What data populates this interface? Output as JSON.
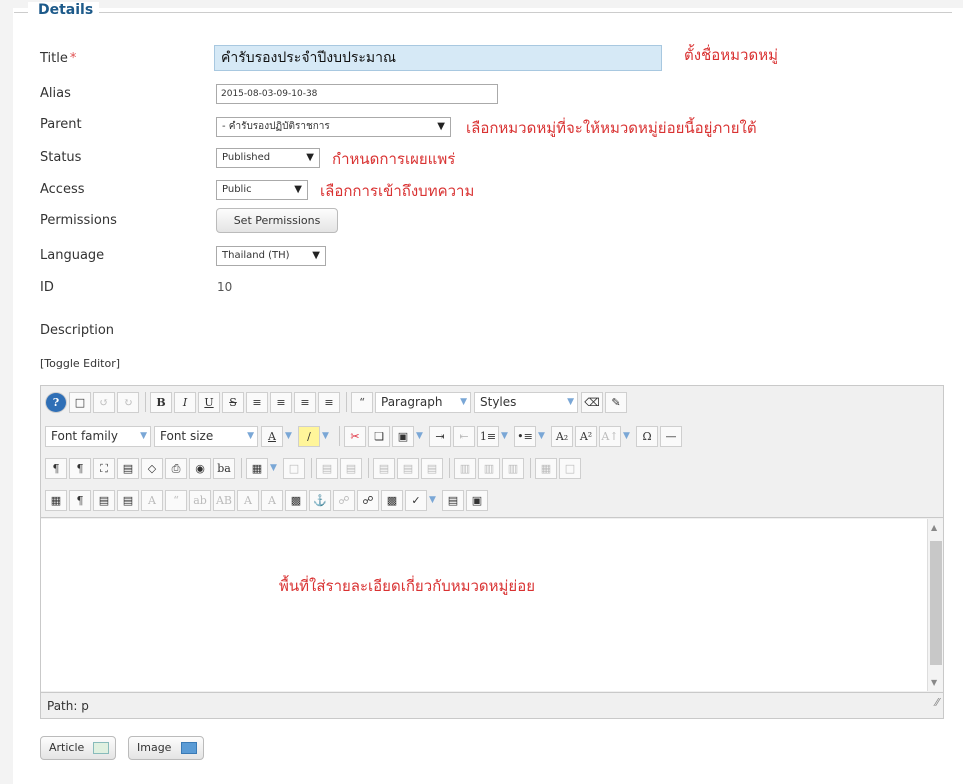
{
  "form": {
    "legend": "Details",
    "title_label": "Title",
    "required_marker": "*",
    "title_value": "คำรับรองประจำปีงบประมาณ",
    "alias_label": "Alias",
    "alias_value": "2015-08-03-09-10-38",
    "parent_label": "Parent",
    "parent_value": "- คำรับรองปฏิบัติราชการ",
    "status_label": "Status",
    "status_value": "Published",
    "access_label": "Access",
    "access_value": "Public",
    "permissions_label": "Permissions",
    "permissions_button": "Set Permissions",
    "language_label": "Language",
    "language_value": "Thailand (TH)",
    "id_label": "ID",
    "id_value": "10",
    "description_label": "Description"
  },
  "annotations": {
    "title_note": "ตั้งชื่อหมวดหมู่",
    "parent_note": "เลือกหมวดหมู่ที่จะให้หมวดหมู่ย่อยนี้อยู่ภายใต้",
    "status_note": "กำหนดการเผยแพร่",
    "access_note": "เลือกการเข้าถึงบทความ",
    "editor_note": "พื้นที่ใส่รายละเอียดเกี่ยวกับหมวดหมู่ย่อย"
  },
  "editor": {
    "toggle_label": "[Toggle Editor]",
    "paragraph_select": "Paragraph",
    "styles_select": "Styles",
    "font_family_select": "Font family",
    "font_size_select": "Font size",
    "path_label": "Path: p"
  },
  "buttons": {
    "article": "Article",
    "image": "Image"
  },
  "icons": {
    "dropdown": "▼",
    "grip": "⁄⁄"
  },
  "colors": {
    "legend": "#1d5a8a",
    "note": "#d93232",
    "title_bg": "#d6e9f6"
  }
}
